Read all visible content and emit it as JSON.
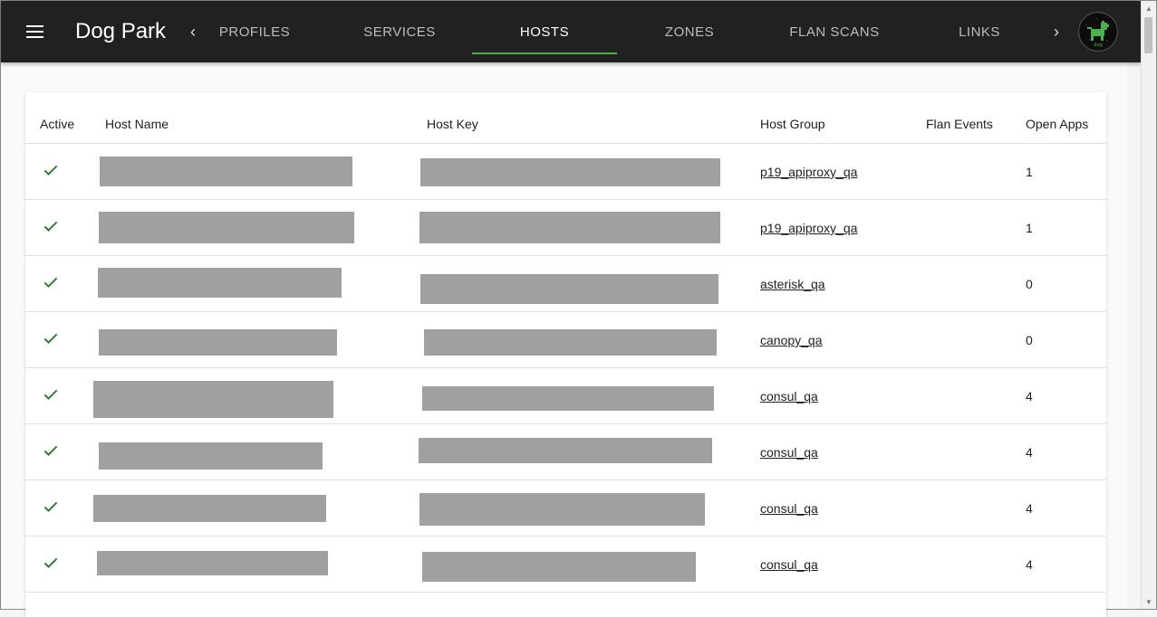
{
  "app": {
    "title": "Dog Park"
  },
  "nav": {
    "tabs": [
      {
        "label": "PROFILES"
      },
      {
        "label": "SERVICES"
      },
      {
        "label": "HOSTS"
      },
      {
        "label": "ZONES"
      },
      {
        "label": "FLAN SCANS"
      },
      {
        "label": "LINKS"
      }
    ],
    "active_tab": "HOSTS"
  },
  "colors": {
    "appbar": "#212121",
    "accent": "#4caf50",
    "check": "#2e7d32",
    "redaction": "#a0a0a0"
  },
  "table": {
    "columns": {
      "active": "Active",
      "host_name": "Host Name",
      "host_key": "Host Key",
      "host_group": "Host Group",
      "flan_events": "Flan Events",
      "open_apps": "Open Apps"
    },
    "rows": [
      {
        "active": true,
        "host_group": "p19_apiproxy_qa",
        "open_apps": "1"
      },
      {
        "active": true,
        "host_group": "p19_apiproxy_qa",
        "open_apps": "1"
      },
      {
        "active": true,
        "host_group": "asterisk_qa",
        "open_apps": "0"
      },
      {
        "active": true,
        "host_group": "canopy_qa",
        "open_apps": "0"
      },
      {
        "active": true,
        "host_group": "consul_qa",
        "open_apps": "4"
      },
      {
        "active": true,
        "host_group": "consul_qa",
        "open_apps": "4"
      },
      {
        "active": true,
        "host_group": "consul_qa",
        "open_apps": "4"
      },
      {
        "active": true,
        "host_group": "consul_qa",
        "open_apps": "4"
      }
    ]
  }
}
